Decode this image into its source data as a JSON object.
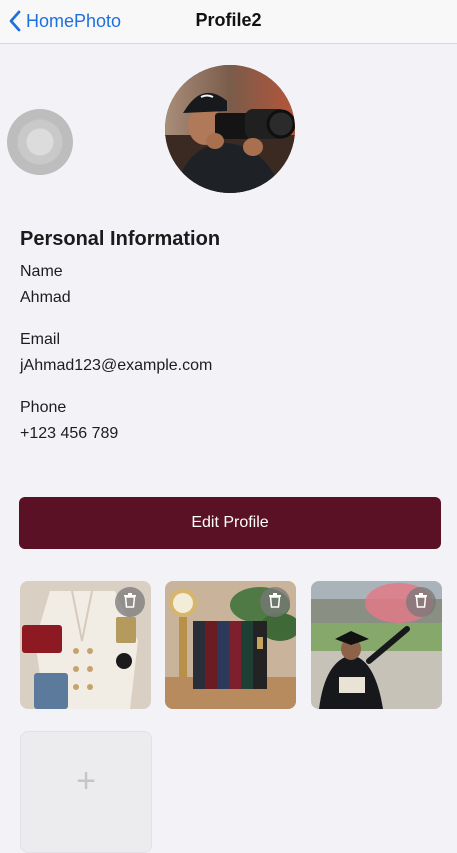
{
  "nav": {
    "back_label": "HomePhoto",
    "title": "Profile2"
  },
  "profile": {
    "section_title": "Personal Information",
    "fields": [
      {
        "label": "Name",
        "value": "Ahmad"
      },
      {
        "label": "Email",
        "value": "jAhmad123@example.com"
      },
      {
        "label": "Phone",
        "value": "+123 456 789"
      }
    ]
  },
  "edit_button_label": "Edit Profile",
  "add_photo_symbol": "+",
  "colors": {
    "accent_blue": "#1f6fe0",
    "button_maroon": "#5b1125",
    "background": "#f3f2f7"
  },
  "icons": {
    "back": "chevron-left-icon",
    "delete": "trash-icon",
    "add": "plus-icon"
  }
}
